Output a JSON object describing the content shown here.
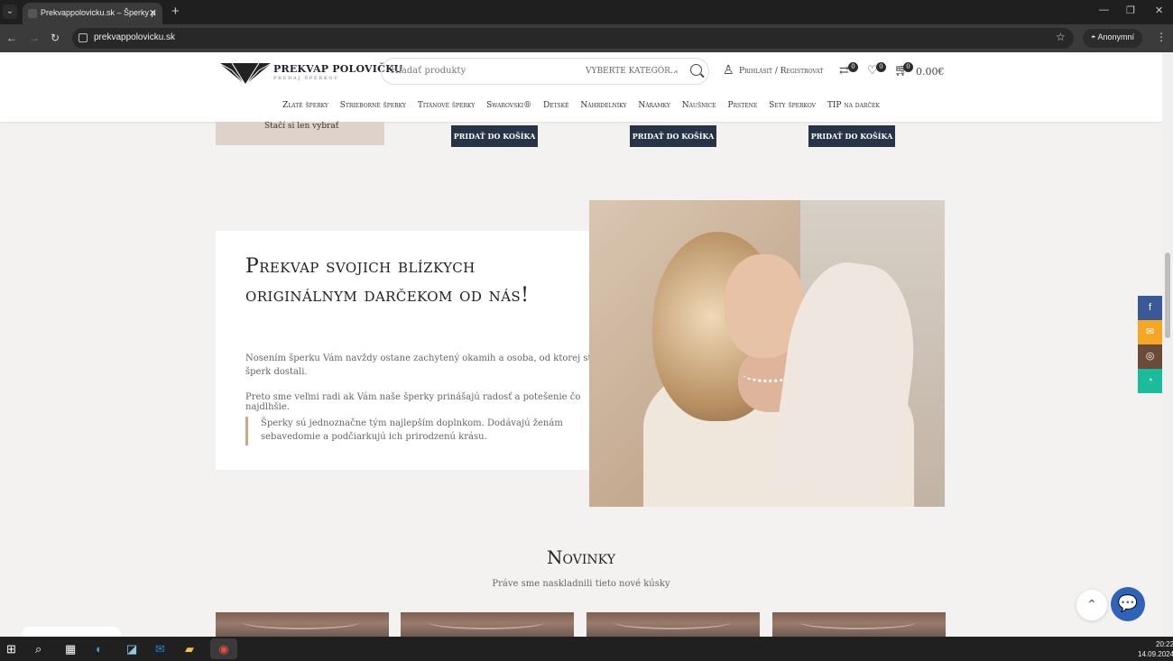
{
  "browser": {
    "tab_title": "Prekvappolovicku.sk – Šperky p",
    "close_tab": "✕",
    "new_tab": "+",
    "url": "prekvappolovicku.sk",
    "profile": "Anonymní",
    "window_buttons": [
      "—",
      "❐",
      "✕"
    ]
  },
  "header": {
    "brand": "PREKVAP POLOVIČKU",
    "brand_sub": "PREDAJ ŠPERKOV",
    "search_placeholder": "Hľadať produkty",
    "category_select": "VYBERTE KATEGÓR...",
    "login": "Prihlásiť / Registrovať",
    "compare_count": "0",
    "wishlist_count": "0",
    "cart_count": "0",
    "cart_total": "0.00€"
  },
  "nav": [
    "Zlaté šperky",
    "Strieborné šperky",
    "Titánové šperky",
    "Swarovski®",
    "Detské",
    "Náhrdelníky",
    "Náramky",
    "Náušnice",
    "Prstene",
    "Sety šperkov",
    "TIP na darček"
  ],
  "top_products": {
    "left_card_text": "Stačí si len vybrať",
    "add_to_cart": "PRIDAŤ DO KOŠÍKA"
  },
  "promo": {
    "title": "Prekvap svojich blízkych originálnym darčekom od nás!",
    "paragraph1": "Nosením šperku Vám navždy ostane zachytený okamih a osoba, od ktorej ste šperk dostali.",
    "paragraph2": "Preto sme veľmi radi ak Vám naše šperky prinášajú radosť a potešenie čo najdlhšie.",
    "quote": "Šperky sú jednoznačne tým najlepším doplnkom. Dodávajú ženám sebavedomie a podčiarkujú ich prirodzenú krásu."
  },
  "new_section": {
    "title": "Novinky",
    "subtitle": "Práve sme naskladnili tieto nové kúsky"
  },
  "floating": {
    "scroll_top": "⌃",
    "chat": "💬"
  },
  "social": [
    {
      "name": "facebook",
      "label": "f",
      "color": "#3b5998"
    },
    {
      "name": "email",
      "label": "✉",
      "color": "#f5a623"
    },
    {
      "name": "instagram",
      "label": "◎",
      "color": "#6b4a3a"
    },
    {
      "name": "whatsapp",
      "label": "◔",
      "color": "#1abc9c"
    }
  ],
  "taskbar": {
    "time": "20:22",
    "date": "14.09.2024"
  }
}
